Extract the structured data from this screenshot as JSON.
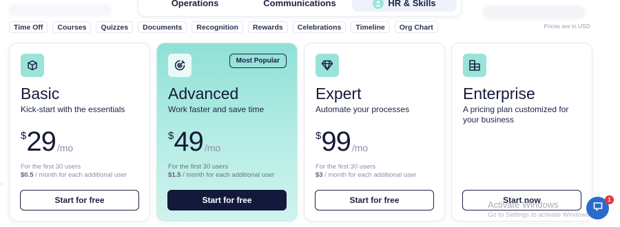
{
  "top_tabs": [
    {
      "label": "Operations",
      "active": false
    },
    {
      "label": "Communications",
      "active": false
    },
    {
      "label": "HR & Skills",
      "active": true,
      "icon": "person-icon"
    }
  ],
  "chips": [
    "Time Off",
    "Courses",
    "Quizzes",
    "Documents",
    "Recognition",
    "Rewards",
    "Celebrations",
    "Timeline",
    "Org Chart"
  ],
  "price_note": "Prices are in USD",
  "plans": [
    {
      "name": "Basic",
      "tagline": "Kick-start with the essentials",
      "currency": "$",
      "price": "29",
      "period": "/mo",
      "users_note": "For the first 30 users",
      "extra_amount": "$0.5",
      "extra_text": " / month for each additional user",
      "cta": "Start for free",
      "icon": "cube-icon"
    },
    {
      "name": "Advanced",
      "tagline": "Work faster and save time",
      "currency": "$",
      "price": "49",
      "period": "/mo",
      "users_note": "For the first 30 users",
      "extra_amount": "$1.5",
      "extra_text": " / month for each additional user",
      "cta": "Start for free",
      "badge": "Most Popular",
      "icon": "target-icon"
    },
    {
      "name": "Expert",
      "tagline": "Automate your processes",
      "currency": "$",
      "price": "99",
      "period": "/mo",
      "users_note": "For the first 30 users",
      "extra_amount": "$3",
      "extra_text": " / month for each additional user",
      "cta": "Start for free",
      "icon": "diamond-icon"
    },
    {
      "name": "Enterprise",
      "tagline": "A pricing plan customized for your business",
      "cta": "Start now",
      "icon": "building-icon"
    }
  ],
  "watermark": {
    "title": "Activate Windows",
    "subtitle": "Go to Settings to activate Windows."
  },
  "chat": {
    "badge_count": "1"
  },
  "colors": {
    "accent": "#99e3d8",
    "navy": "#13193a",
    "featured_top": "#8fe0d6",
    "chat_blue": "#2a6cc9"
  }
}
